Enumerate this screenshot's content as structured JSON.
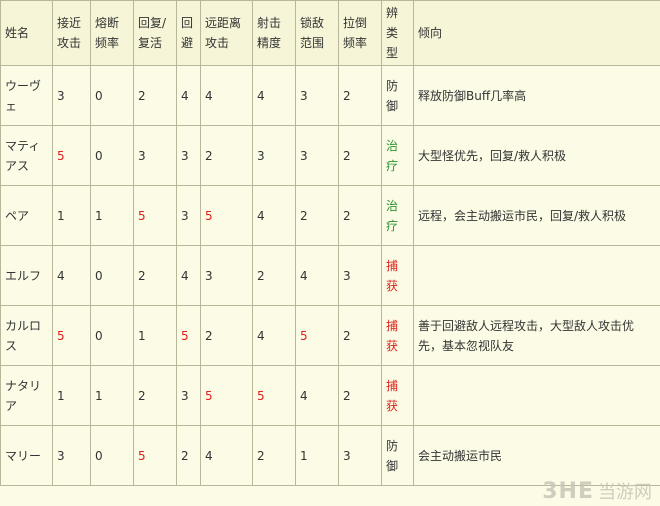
{
  "headers": [
    "姓名",
    "接近攻击",
    "熔断频率",
    "回复/复活",
    "回避",
    "远距离攻击",
    "射击精度",
    "锁敌范围",
    "拉倒频率",
    "辨类型",
    "倾向"
  ],
  "rows": [
    [
      "ウーヴェ",
      "3",
      "0",
      "2",
      "4",
      "4",
      "4",
      "3",
      "2",
      "防御",
      "释放防御Buff几率高"
    ],
    [
      "マティアス",
      "5",
      "0",
      "3",
      "3",
      "2",
      "3",
      "3",
      "2",
      "治疗",
      "大型怪优先，回复/救人积极"
    ],
    [
      "ペア",
      "1",
      "1",
      "5",
      "3",
      "5",
      "4",
      "2",
      "2",
      "治疗",
      "远程，会主动搬运市民，回复/救人积极"
    ],
    [
      "エルフ",
      "4",
      "0",
      "2",
      "4",
      "3",
      "2",
      "4",
      "3",
      "捕获",
      ""
    ],
    [
      "カルロス",
      "5",
      "0",
      "1",
      "5",
      "2",
      "4",
      "5",
      "2",
      "捕获",
      "善于回避敌人远程攻击，大型敌人攻击优先，基本忽视队友"
    ],
    [
      "ナタリア",
      "1",
      "1",
      "2",
      "3",
      "5",
      "5",
      "4",
      "2",
      "捕获",
      ""
    ],
    [
      "マリー",
      "3",
      "0",
      "5",
      "2",
      "4",
      "2",
      "1",
      "3",
      "防御",
      "会主动搬运市民"
    ]
  ],
  "highlight": {
    "red_value": "5",
    "type_colors": {
      "治疗": "#2e9330",
      "捕获": "#e0201c",
      "防御": "#333333"
    }
  },
  "watermark": {
    "logo": "3HE",
    "text": "当游网"
  }
}
